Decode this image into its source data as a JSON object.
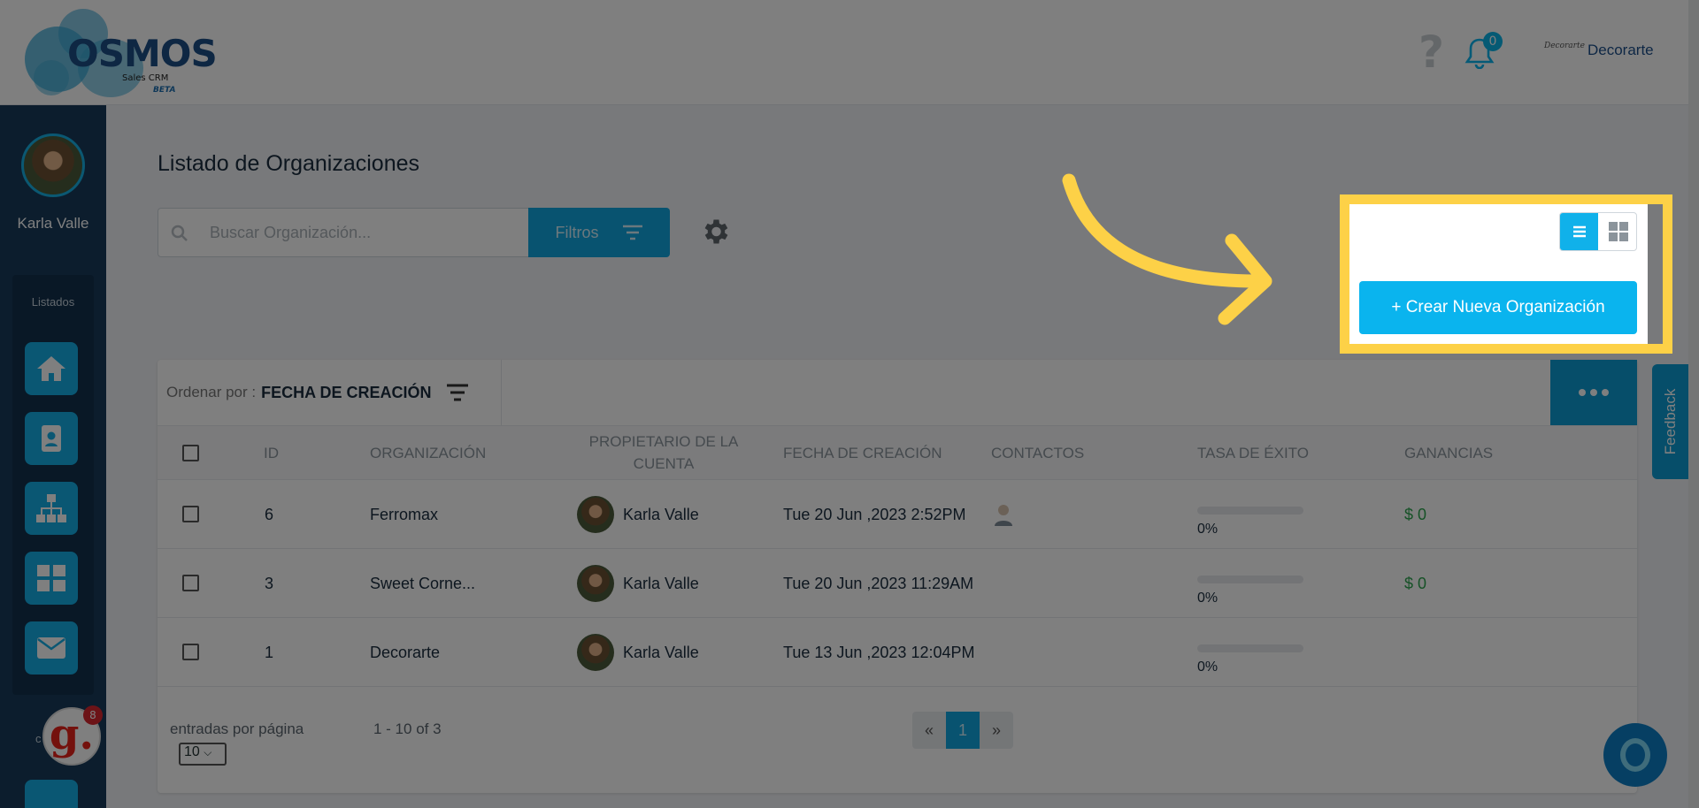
{
  "header": {
    "logo_name": "OSMOS",
    "logo_sub": "Sales CRM",
    "logo_beta": "BETA",
    "help_glyph": "?",
    "notifications_count": "0",
    "company_logo_text": "Decorarte",
    "company_name": "Decorarte",
    "icons": {
      "help": "help-icon",
      "notifications": "bell-icon"
    }
  },
  "sidebar": {
    "user_name": "Karla Valle",
    "section_label": "Listados",
    "items": [
      {
        "icon": "home-icon"
      },
      {
        "icon": "contact-card-icon"
      },
      {
        "icon": "org-chart-icon"
      },
      {
        "icon": "dashboard-icon"
      },
      {
        "icon": "mail-icon"
      }
    ],
    "widget_letter": "g.",
    "widget_count": "8",
    "partial_label": "c"
  },
  "main": {
    "title": "Listado de Organizaciones",
    "search_placeholder": "Buscar Organización...",
    "filters_label": "Filtros",
    "create_button": "+ Crear Nueva Organización",
    "sort_label": "Ordenar por :",
    "sort_value": "FECHA DE CREACIÓN",
    "columns": {
      "id": "ID",
      "organization": "ORGANIZACIÓN",
      "owner": "PROPIETARIO DE LA CUENTA",
      "created": "FECHA DE CREACIÓN",
      "contacts": "CONTACTOS",
      "success_rate": "TASA DE ÉXITO",
      "earnings": "GANANCIAS"
    },
    "rows": [
      {
        "id": "6",
        "organization": "Ferromax",
        "owner": "Karla Valle",
        "created": "Tue 20 Jun ,2023 2:52PM",
        "has_contact": true,
        "rate": "0%",
        "rate_value": 0,
        "earnings": "$ 0"
      },
      {
        "id": "3",
        "organization": "Sweet Corne...",
        "owner": "Karla Valle",
        "created": "Tue 20 Jun ,2023 11:29AM",
        "has_contact": false,
        "rate": "0%",
        "rate_value": 0,
        "earnings": "$ 0"
      },
      {
        "id": "1",
        "organization": "Decorarte",
        "owner": "Karla Valle",
        "created": "Tue 13 Jun ,2023 12:04PM",
        "has_contact": false,
        "rate": "0%",
        "rate_value": 0,
        "earnings": ""
      }
    ],
    "footer": {
      "per_page_label": "entradas por página",
      "per_page_value": "10",
      "range": "1 - 10 of 3",
      "prev": "«",
      "current_page": "1",
      "next": "»"
    }
  },
  "feedback_label": "Feedback",
  "colors": {
    "accent": "#0ab4ee",
    "highlight": "#fdd147",
    "sidebar": "#183b5b",
    "gain": "#2da44e"
  }
}
